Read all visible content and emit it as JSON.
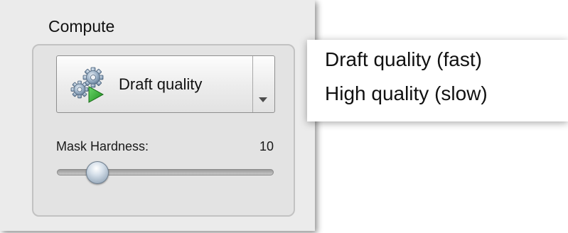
{
  "compute": {
    "title": "Compute",
    "quality_button": {
      "label": "Draft quality",
      "icon": "gears-play-icon"
    },
    "mask_hardness": {
      "label": "Mask Hardness:",
      "value": "10",
      "slider_fraction": 0.15
    }
  },
  "quality_menu": {
    "options": [
      "Draft quality (fast)",
      "High quality (slow)"
    ]
  },
  "colors": {
    "panel_bg": "#ebebeb",
    "play_green": "#2fae2f",
    "gear_blue": "#8aa8c4"
  }
}
